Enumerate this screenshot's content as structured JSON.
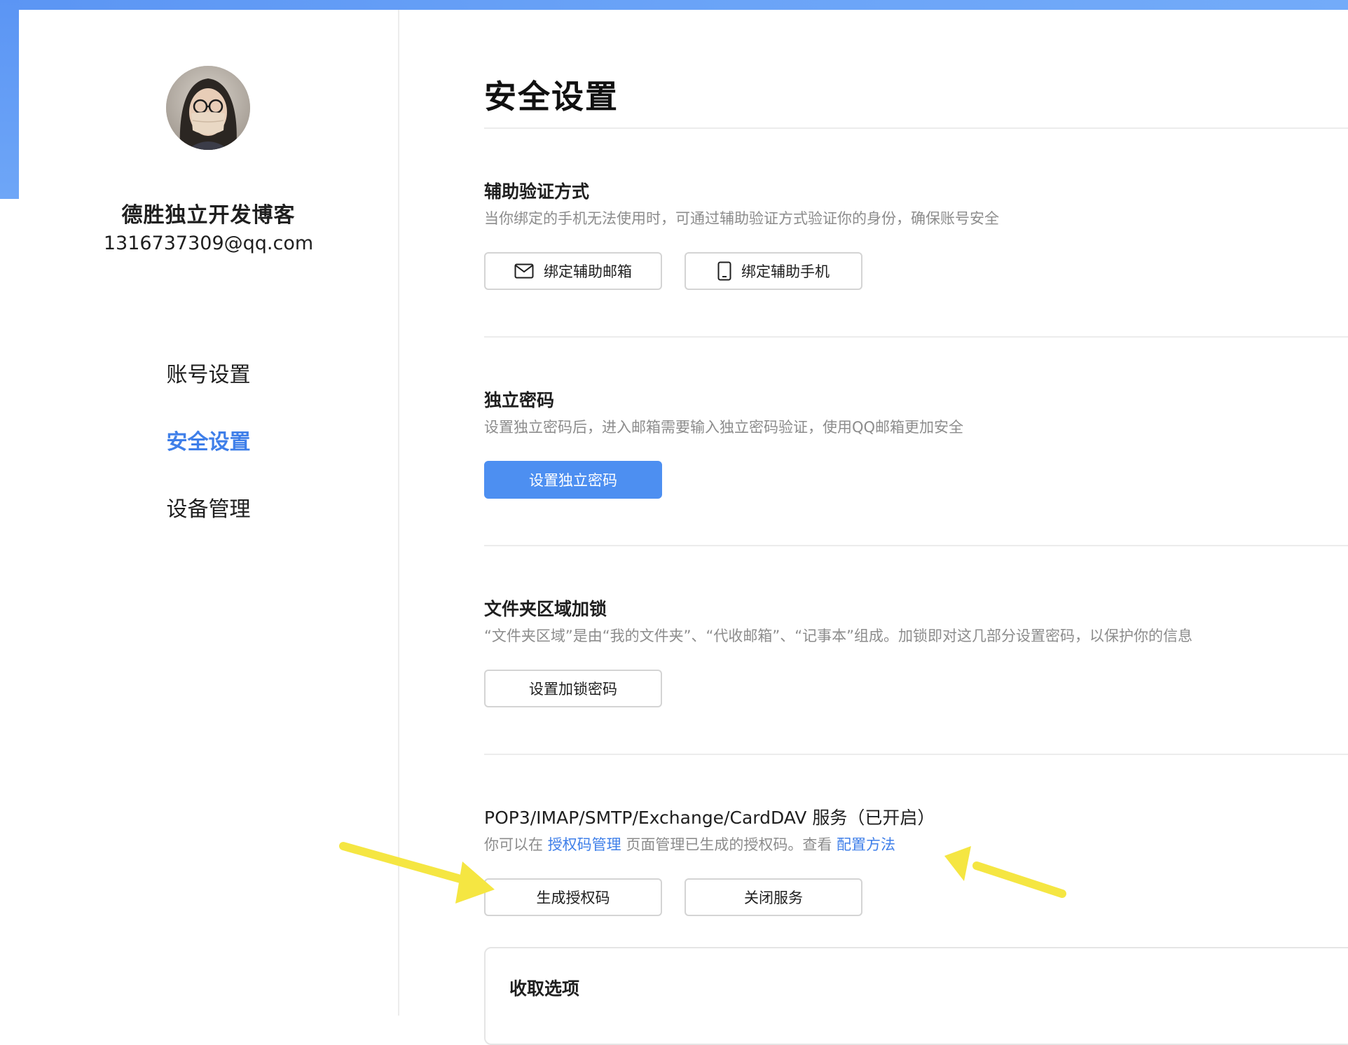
{
  "user": {
    "name": "德胜独立开发博客",
    "email": "1316737309@qq.com"
  },
  "nav": {
    "items": [
      {
        "label": "账号设置",
        "active": false
      },
      {
        "label": "安全设置",
        "active": true
      },
      {
        "label": "设备管理",
        "active": false
      }
    ]
  },
  "main": {
    "title": "安全设置",
    "sections": {
      "aux_verify": {
        "title": "辅助验证方式",
        "desc": "当你绑定的手机无法使用时，可通过辅助验证方式验证你的身份，确保账号安全",
        "buttons": {
          "bind_email": "绑定辅助邮箱",
          "bind_phone": "绑定辅助手机"
        }
      },
      "standalone_password": {
        "title": "独立密码",
        "desc": "设置独立密码后，进入邮箱需要输入独立密码验证，使用QQ邮箱更加安全",
        "button": "设置独立密码"
      },
      "folder_lock": {
        "title": "文件夹区域加锁",
        "desc": "“文件夹区域”是由“我的文件夹”、“代收邮箱”、“记事本”组成。加锁即对这几部分设置密码，以保护你的信息",
        "button": "设置加锁密码"
      },
      "protocol_service": {
        "title": "POP3/IMAP/SMTP/Exchange/CardDAV 服务（已开启）",
        "desc_part1": "你可以在 ",
        "desc_link1": "授权码管理",
        "desc_part2": " 页面管理已生成的授权码。查看 ",
        "desc_link2": "配置方法",
        "buttons": {
          "generate_code": "生成授权码",
          "close_service": "关闭服务"
        }
      }
    },
    "card": {
      "title": "收取选项"
    }
  },
  "colors": {
    "accent": "#3f7fe9",
    "primary_button": "#4d8ff1",
    "annotation_arrow": "#f5e642"
  },
  "icons": {
    "bind_email_button": "mail-icon",
    "bind_phone_button": "phone-icon"
  }
}
